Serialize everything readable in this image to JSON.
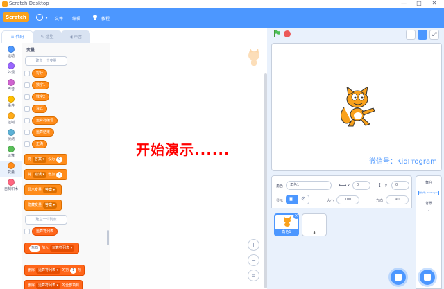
{
  "window": {
    "title": "Scratch Desktop",
    "controls": [
      "—",
      "□",
      "✕"
    ]
  },
  "menu": {
    "logo": "Scratch",
    "file": "文件",
    "edit": "编辑",
    "tutorials": "教程"
  },
  "tabs": {
    "code": "代码",
    "costumes": "造型",
    "sounds": "声音"
  },
  "categories": [
    {
      "label": "运动",
      "color": "#4c97ff"
    },
    {
      "label": "外观",
      "color": "#9966ff"
    },
    {
      "label": "声音",
      "color": "#cf63cf"
    },
    {
      "label": "事件",
      "color": "#ffbf00"
    },
    {
      "label": "控制",
      "color": "#ffab19"
    },
    {
      "label": "侦测",
      "color": "#5cb1d6"
    },
    {
      "label": "运算",
      "color": "#59c059"
    },
    {
      "label": "变量",
      "color": "#ff8c1a"
    },
    {
      "label": "自制积木",
      "color": "#ff6680"
    }
  ],
  "palette": {
    "title": "变量",
    "make_var": "建立一个变量",
    "vars": [
      "得分",
      "数字1",
      "数字2",
      "算式",
      "运算符编号",
      "运算结果",
      "正确"
    ],
    "set_block": {
      "label": "将",
      "var": "答案",
      "mid": "设为",
      "value": "0"
    },
    "change_block": {
      "label": "将",
      "var": "错误",
      "mid": "增加",
      "value": "1"
    },
    "show_block": {
      "label": "显示变量",
      "var": "答案"
    },
    "hide_block": {
      "label": "隐藏变量",
      "var": "答案"
    },
    "make_list": "建立一个列表",
    "list_name": "运算符列表",
    "add_block": {
      "value": "东西",
      "mid": "加入",
      "list": "运算符列表"
    },
    "delete_block": {
      "label": "删除",
      "list": "运算符列表",
      "mid": "的第",
      "value": "1",
      "tail": "项"
    },
    "delete_all_block": {
      "label": "删除",
      "list": "运算符列表",
      "tail": "的全部项目"
    }
  },
  "overlay": {
    "text": "开始演示......"
  },
  "stage": {
    "watermark": "微信号：KidProgram"
  },
  "sprite_info": {
    "sprite_label": "角色",
    "sprite_name": "角色1",
    "x_label": "x",
    "x_value": "0",
    "y_label": "y",
    "y_value": "0",
    "show_label": "显示",
    "size_label": "大小",
    "size_value": "100",
    "direction_label": "方向",
    "direction_value": "90"
  },
  "sprites": [
    {
      "name": "角色1",
      "selected": true
    },
    {
      "name": "a",
      "selected": false
    }
  ],
  "stage_pane": {
    "title": "舞台",
    "backdrop_label": "背景",
    "backdrop_count": "2",
    "thumb_text": "微信号：KidProgram"
  },
  "zoom": {
    "in": "+",
    "out": "−",
    "reset": "="
  }
}
